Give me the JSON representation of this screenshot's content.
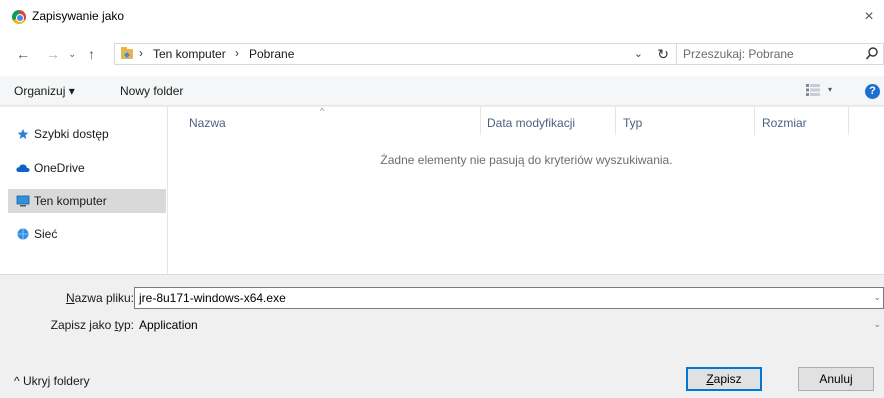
{
  "window": {
    "title": "Zapisywanie jako",
    "close": "×"
  },
  "nav": {
    "back": "←",
    "forward": "→",
    "recent": "⌄",
    "up": "↑"
  },
  "breadcrumb": {
    "separator": "›",
    "items": [
      "Ten komputer",
      "Pobrane"
    ],
    "dropdown": "⌄",
    "refresh": "↻"
  },
  "search": {
    "placeholder": "Przeszukaj: Pobrane"
  },
  "toolbar": {
    "organize": "Organizuj ▾",
    "new_folder": "Nowy folder",
    "view_arrow": "▾",
    "help": "?"
  },
  "sidebar": {
    "items": [
      {
        "label": "Szybki dostęp",
        "icon": "star-icon"
      },
      {
        "label": "OneDrive",
        "icon": "cloud-icon"
      },
      {
        "label": "Ten komputer",
        "icon": "computer-icon",
        "selected": true
      },
      {
        "label": "Sieć",
        "icon": "network-icon"
      }
    ]
  },
  "filelist": {
    "columns": [
      "Nazwa",
      "Data modyfikacji",
      "Typ",
      "Rozmiar"
    ],
    "sort_indicator": "^",
    "empty_message": "Żadne elementy nie pasują do kryteriów wyszukiwania."
  },
  "form": {
    "filename_label_u": "N",
    "filename_label_rest": "azwa pliku:",
    "filename_value": "jre-8u171-windows-x64.exe",
    "type_label_a": "Zapisz jako ",
    "type_label_u": "t",
    "type_label_b": "yp:",
    "type_value": "Application",
    "dropdown": "⌄"
  },
  "footer": {
    "hide_folders": "^ Ukryj foldery",
    "save_u": "Z",
    "save_rest": "apisz",
    "cancel": "Anuluj"
  },
  "colors": {
    "accent": "#0078d7",
    "selected": "#d9d9d9",
    "header_text": "#4d6082"
  }
}
